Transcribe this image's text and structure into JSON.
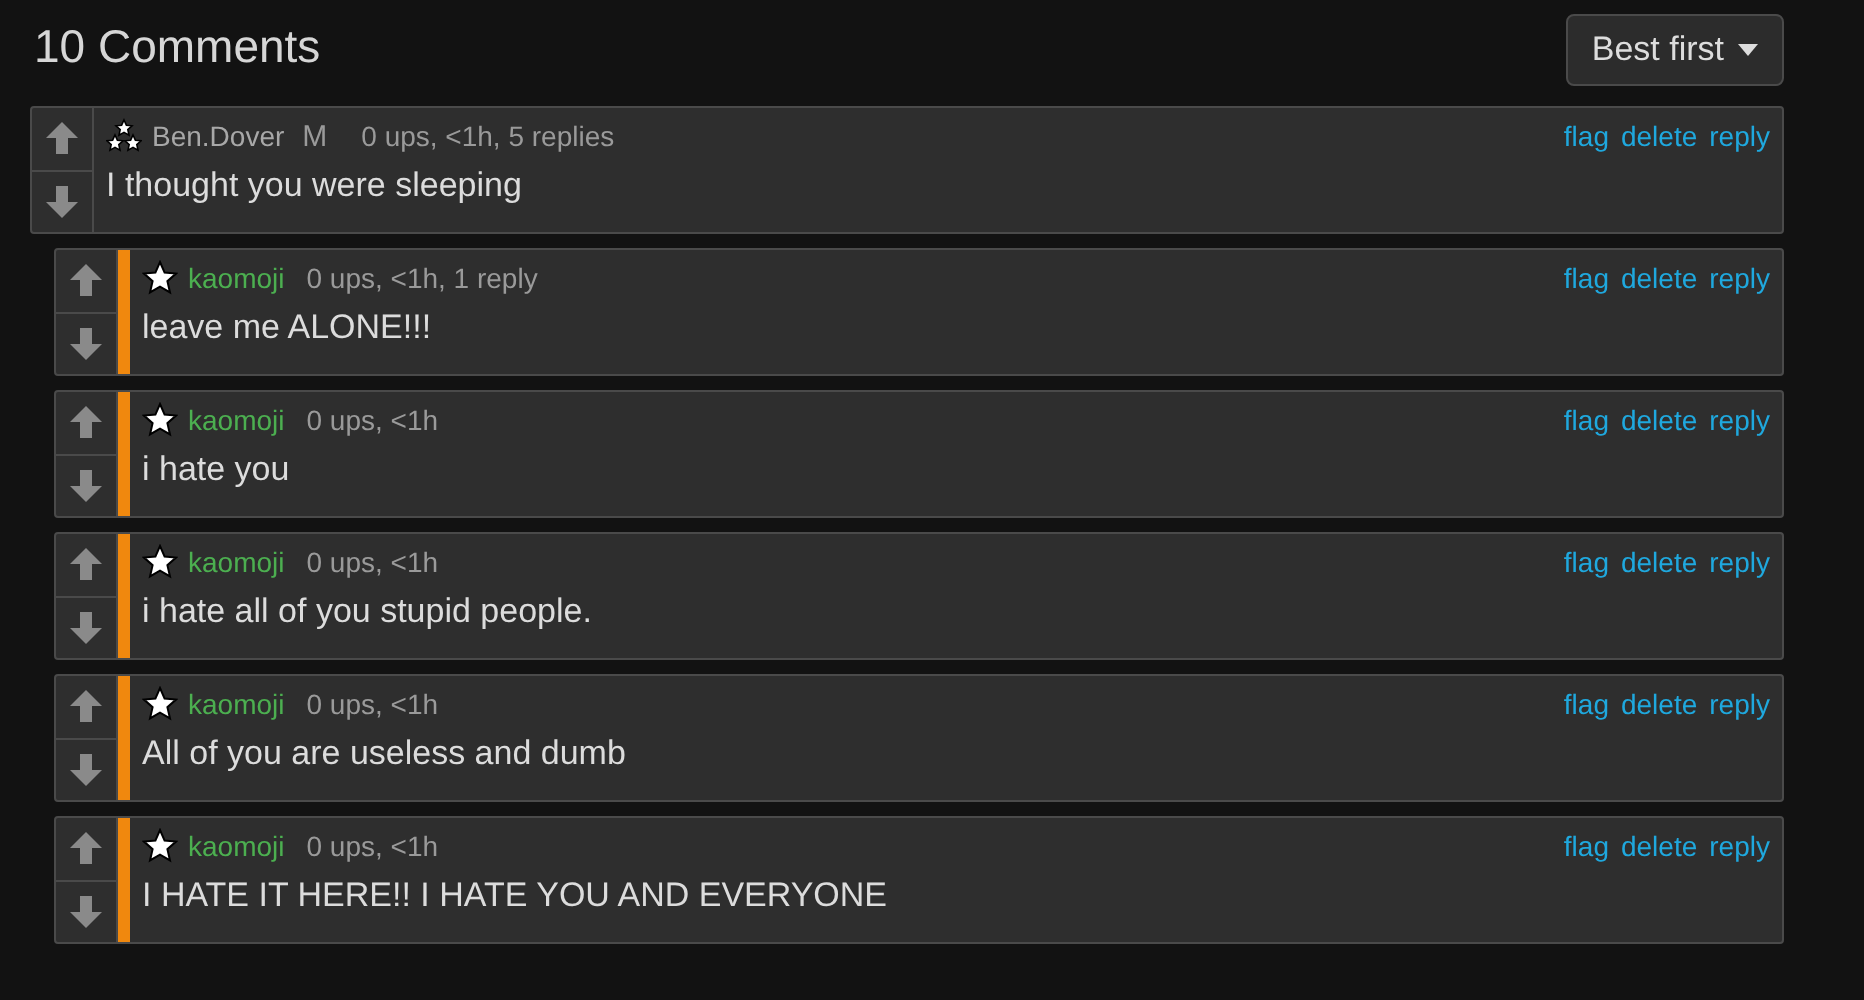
{
  "header": {
    "title": "10 Comments",
    "sort": "Best first"
  },
  "comments": [
    {
      "kind": "top",
      "user": "Ben.Dover",
      "color": "#a8a8a8",
      "badge": "M",
      "meta": "0 ups, <1h, 5 replies",
      "text": "I thought you were sleeping",
      "actions": [
        "flag",
        "delete",
        "reply"
      ]
    },
    {
      "kind": "reply",
      "user": "kaomoji",
      "color": "#4caf50",
      "meta": "0 ups, <1h, 1 reply",
      "text": "leave me ALONE!!!",
      "actions": [
        "flag",
        "delete",
        "reply"
      ]
    },
    {
      "kind": "reply",
      "user": "kaomoji",
      "color": "#4caf50",
      "meta": "0 ups, <1h",
      "text": "i hate you",
      "actions": [
        "flag",
        "delete",
        "reply"
      ]
    },
    {
      "kind": "reply",
      "user": "kaomoji",
      "color": "#4caf50",
      "meta": "0 ups, <1h",
      "text": "i hate all of you stupid people.",
      "actions": [
        "flag",
        "delete",
        "reply"
      ]
    },
    {
      "kind": "reply",
      "user": "kaomoji",
      "color": "#4caf50",
      "meta": "0 ups, <1h",
      "text": "All of you are useless and dumb",
      "actions": [
        "flag",
        "delete",
        "reply"
      ]
    },
    {
      "kind": "reply",
      "user": "kaomoji",
      "color": "#4caf50",
      "meta": "0 ups, <1h",
      "text": "I HATE IT HERE!! I HATE YOU AND EVERYONE",
      "actions": [
        "flag",
        "delete",
        "reply"
      ]
    }
  ]
}
